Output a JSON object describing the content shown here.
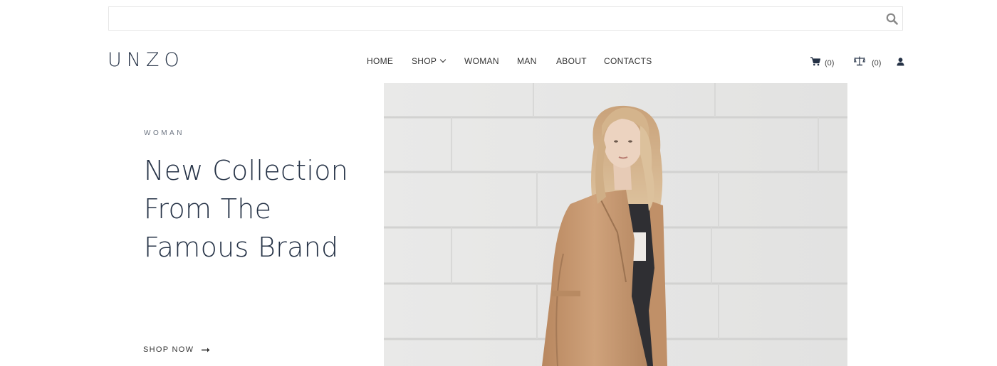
{
  "search": {
    "placeholder": "",
    "value": "",
    "icon": "search-icon"
  },
  "header": {
    "logo": "UNZO",
    "nav": [
      {
        "label": "HOME"
      },
      {
        "label": "SHOP",
        "has_dropdown": true
      },
      {
        "label": "WOMAN"
      },
      {
        "label": "MAN"
      },
      {
        "label": "ABOUT"
      },
      {
        "label": "CONTACTS"
      }
    ],
    "cart_count": "(0)",
    "compare_count": "(0)"
  },
  "hero": {
    "eyebrow": "WOMAN",
    "headline": "New Collection From The Famous Brand",
    "cta_label": "SHOP NOW"
  },
  "colors": {
    "brand_dark": "#253246",
    "coat": "#c79a73",
    "wall": "#e7e7e6"
  }
}
